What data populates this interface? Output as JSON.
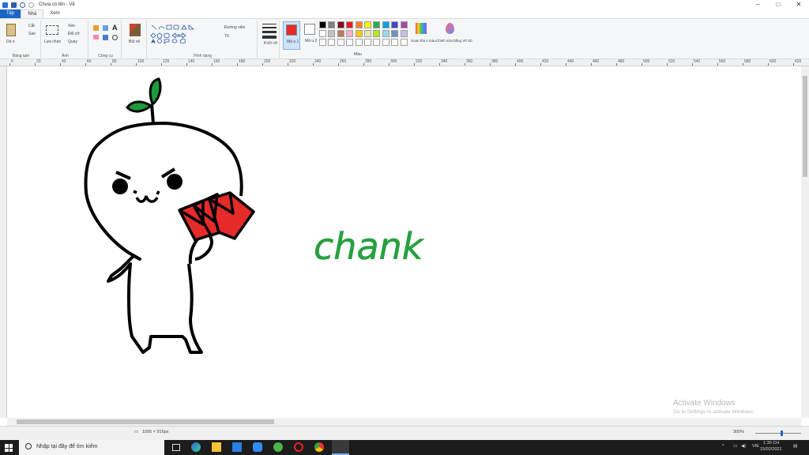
{
  "window": {
    "title": "Chưa có tên - Vẽ",
    "controls": [
      "–",
      "□",
      "✕"
    ]
  },
  "tabs": {
    "file": "Tệp",
    "home": "Nhà",
    "view": "Xem"
  },
  "ribbon": {
    "clipboard": {
      "paste": "Dá n",
      "cut": "Cắt",
      "copy": "Sao",
      "label": "Bảng tạm"
    },
    "image": {
      "select": "Lựa chọn",
      "crop": "Xén",
      "resize": "Đổi cỡ",
      "rotate": "Quay",
      "label": "Ảnh"
    },
    "tools": {
      "label": "Công cụ"
    },
    "brushes": {
      "label": "Bút vẽ"
    },
    "shapes": {
      "outline": "Đường viền",
      "fill": "Tô",
      "label": "Hình dạng"
    },
    "size": {
      "label": "Kích cỡ"
    },
    "color1": {
      "label": "Mà u 1",
      "value": "#e52a2a"
    },
    "color2": {
      "label": "Mà u 2",
      "value": "#ffffff"
    },
    "edit_colors": "Soạn thả o màu",
    "paint3d": "Chỉnh sửa bằng Vẽ 3D",
    "colors_label": "Màu",
    "palette": [
      "#000000",
      "#7f7f7f",
      "#880015",
      "#ed1c24",
      "#ff7f27",
      "#fff200",
      "#22b14c",
      "#00a2e8",
      "#3f48cc",
      "#a349a4",
      "#ffffff",
      "#c3c3c3",
      "#b97a57",
      "#ffaec9",
      "#ffc90e",
      "#efe4b0",
      "#b5e61d",
      "#99d9ea",
      "#7092be",
      "#c8bfe7"
    ]
  },
  "ruler": {
    "ticks": [
      "0",
      "20",
      "40",
      "60",
      "80",
      "100",
      "120",
      "140",
      "160",
      "180",
      "200",
      "220",
      "240",
      "260",
      "280",
      "300",
      "320",
      "340",
      "360",
      "380",
      "400",
      "420",
      "440",
      "460",
      "480",
      "500",
      "520",
      "540",
      "560",
      "580",
      "600",
      "620"
    ]
  },
  "canvas": {
    "text": "chank",
    "text_color": "#27a040",
    "leaf_color": "#1f9a3a",
    "card_color": "#e52a2a"
  },
  "statusbar": {
    "size": "1095 × 916px",
    "zoom": "300%"
  },
  "watermark": {
    "line1": "Activate Windows",
    "line2": "Go to Settings to activate Windows."
  },
  "taskbar": {
    "search_placeholder": "Nhập tại đây để tìm kiếm",
    "lang": "VIE",
    "time": "1:30 CH",
    "date": "15/02/2021"
  }
}
